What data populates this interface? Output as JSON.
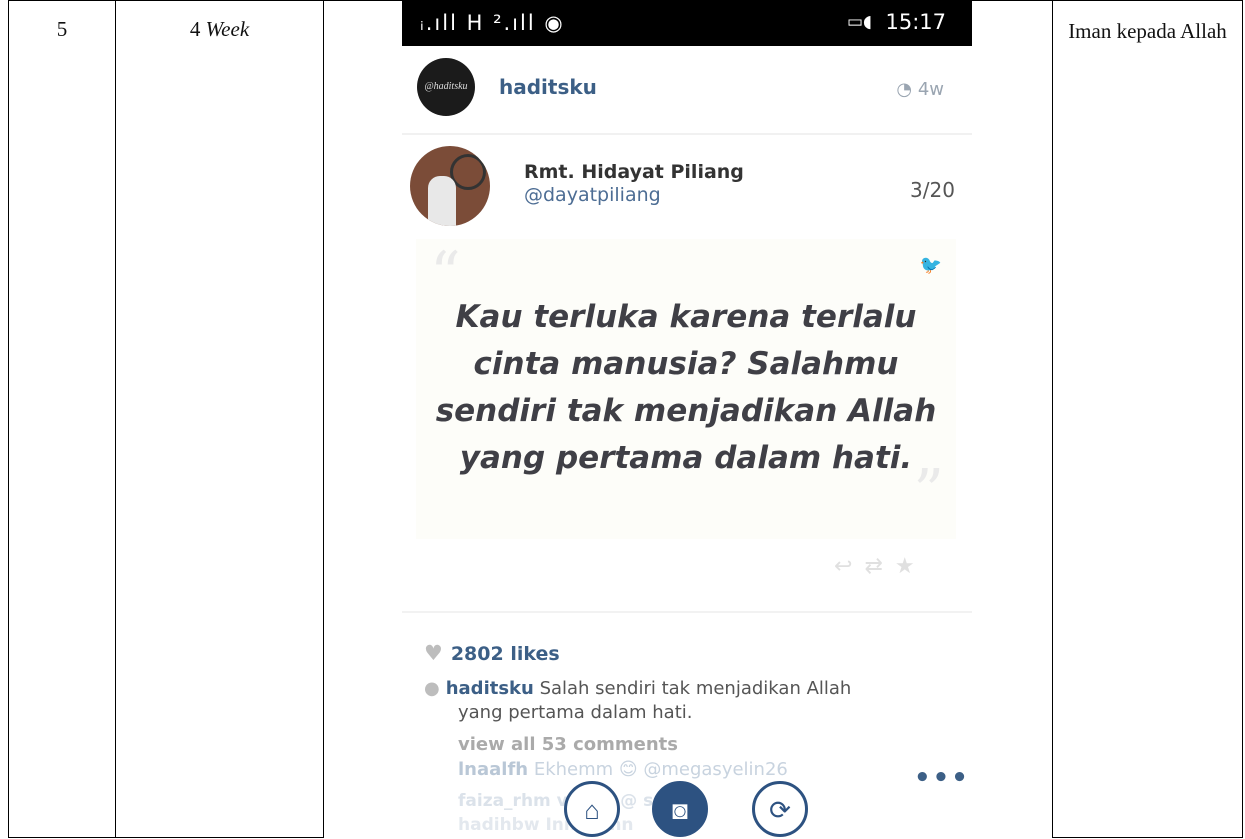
{
  "row": {
    "number": "5",
    "week_num": "4",
    "week_word": "Week",
    "topic": "Iman kepada Allah"
  },
  "phone": {
    "status": {
      "signal_text": "ᵢ.ıll H ².ıll ◉",
      "battery_icon": "battery-icon",
      "time": "15:17"
    },
    "post": {
      "avatar_text": "@haditsku",
      "account": "haditsku",
      "time_ago": "4w"
    },
    "tweet": {
      "name": "Rmt. Hidayat Piliang",
      "handle": "@dayatpiliang",
      "count": "3/20",
      "quote": "Kau terluka karena terlalu cinta manusia? Salahmu sendiri tak menjadikan Allah yang pertama dalam hati."
    },
    "likes": "2802 likes",
    "caption_user": "haditsku",
    "caption_text": " Salah sendiri tak menjadikan Allah",
    "caption_text2": "yang pertama dalam hati.",
    "view_comments": "view all 53 comments",
    "comment1_user": "lnaalfh",
    "comment1_text": " Ekhemm 😊 @megasyelin26",
    "comment2": "faiza_rhm  viaii  ii @  srna",
    "comment3": "hadihbw  Inna sinn",
    "more": "•••"
  },
  "colors": {
    "accent": "#3c5f86",
    "nav": "#2d5281"
  }
}
